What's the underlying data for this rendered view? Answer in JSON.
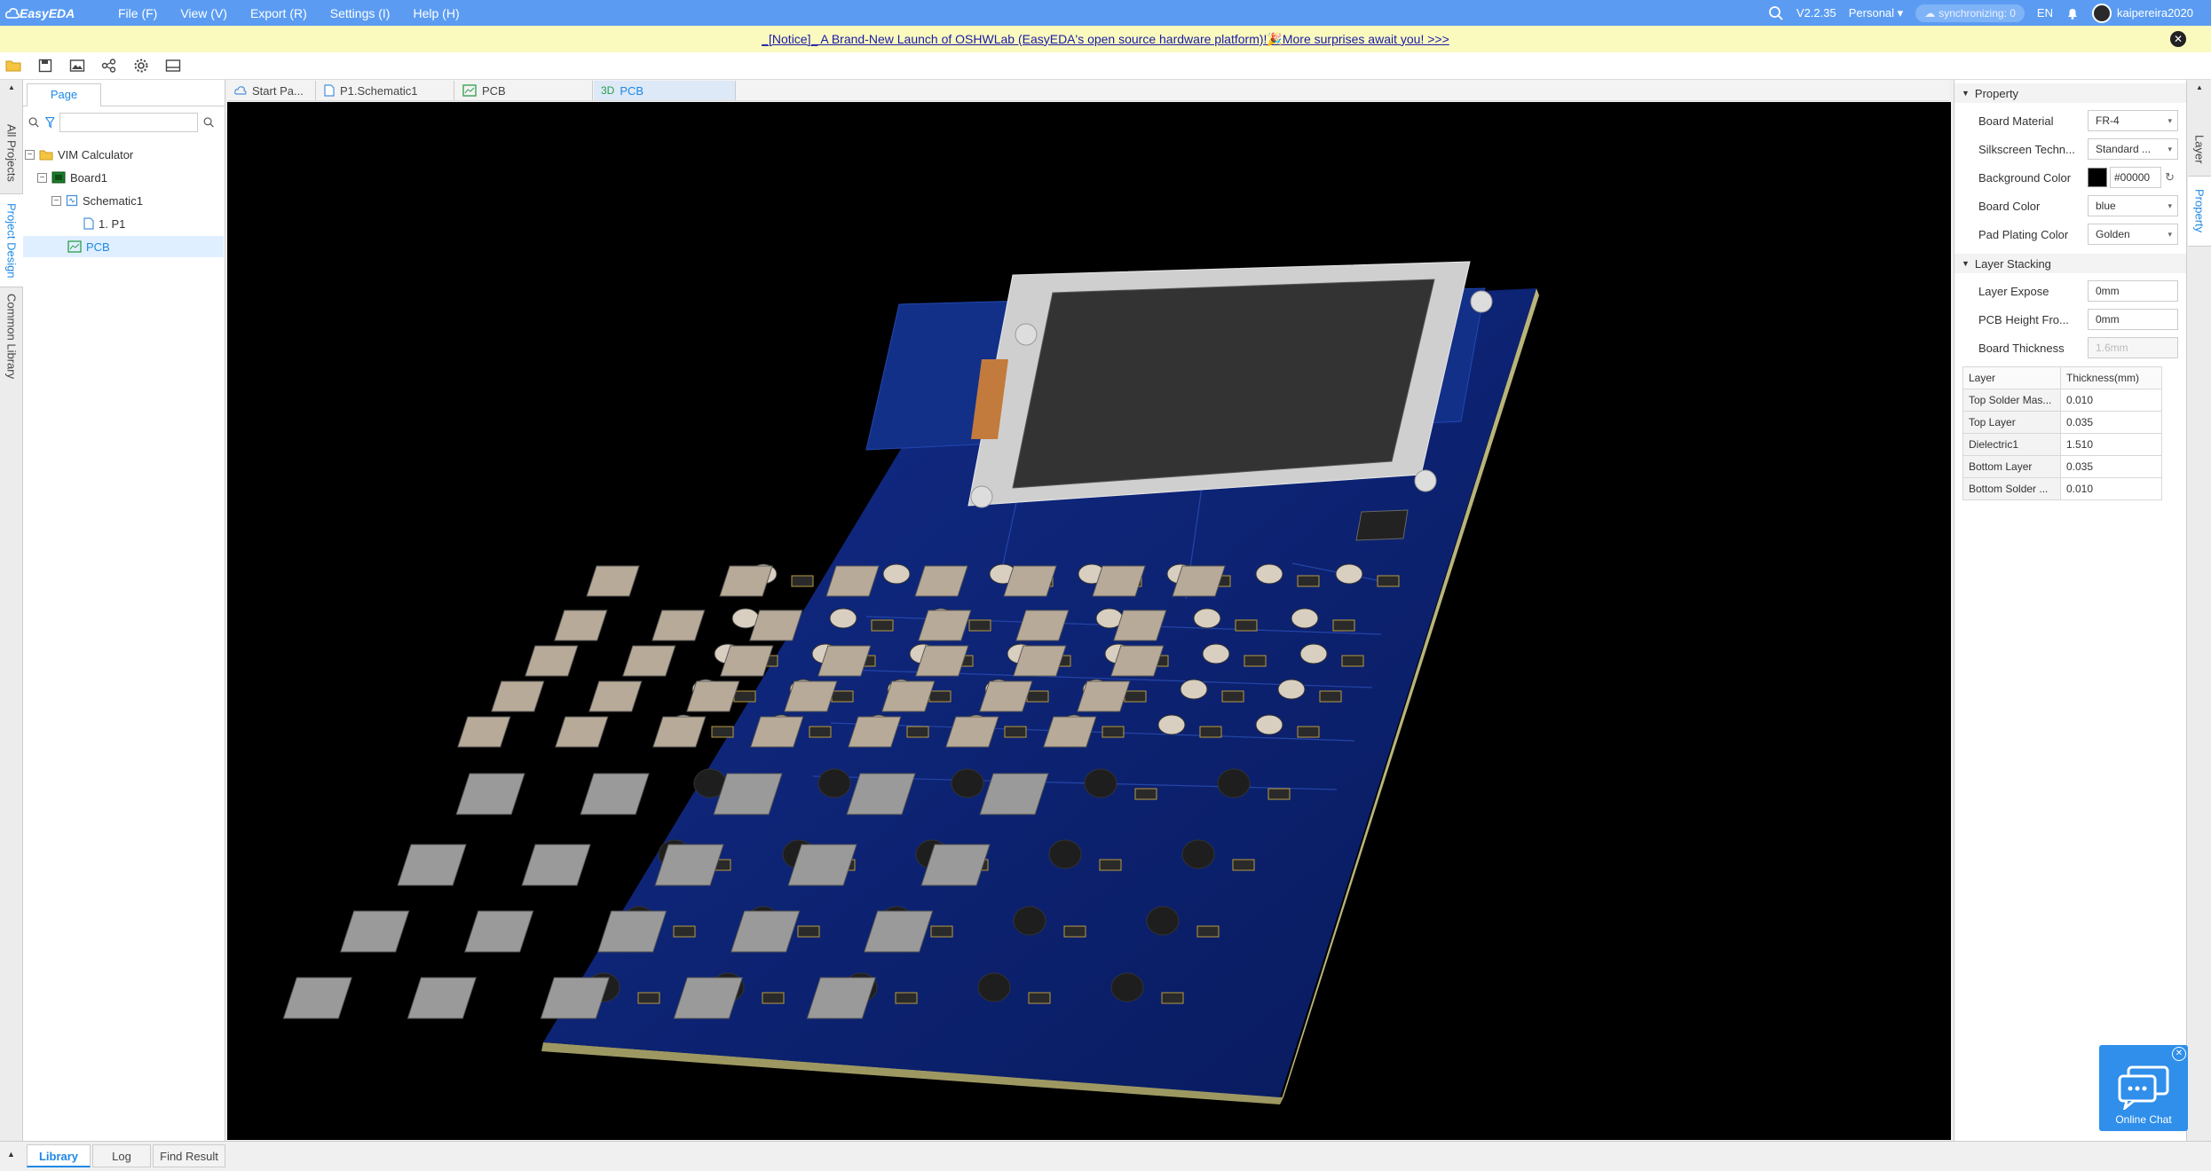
{
  "app": {
    "logo_text": "EasyEDA",
    "menu": [
      "File (F)",
      "View (V)",
      "Export (R)",
      "Settings (I)",
      "Help (H)"
    ],
    "version": "V2.2.35",
    "edition": "Personal",
    "sync_status": "synchronizing: 0",
    "language": "EN",
    "username": "kaipereira2020"
  },
  "notice": {
    "text": "_[Notice]_ A Brand-New Launch of OSHWLab (EasyEDA's open source hardware platform)!🎉More surprises await you! >>>"
  },
  "left_vtabs": [
    "All Projects",
    "Project Design",
    "Common Library"
  ],
  "left_panel": {
    "tab": "Page",
    "tree": {
      "project": "VIM Calculator",
      "board": "Board1",
      "schematic": "Schematic1",
      "sheet": "1. P1",
      "pcb": "PCB"
    }
  },
  "doc_tabs": [
    "Start Pa...",
    "P1.Schematic1",
    "PCB",
    "PCB"
  ],
  "doc_tab_3d_prefix": "3D",
  "right_vtabs": [
    "Layer",
    "Property"
  ],
  "property_panel": {
    "section_property": "Property",
    "rows": [
      {
        "label": "Board Material",
        "value": "FR-4"
      },
      {
        "label": "Silkscreen Techn...",
        "value": "Standard ..."
      },
      {
        "label": "Background Color",
        "value": "#00000"
      },
      {
        "label": "Board Color",
        "value": "blue"
      },
      {
        "label": "Pad Plating Color",
        "value": "Golden"
      }
    ],
    "section_stacking": "Layer Stacking",
    "stacking_rows": [
      {
        "label": "Layer Expose",
        "value": "0mm"
      },
      {
        "label": "PCB Height Fro...",
        "value": "0mm"
      },
      {
        "label": "Board Thickness",
        "value": "1.6mm"
      }
    ],
    "table_headers": [
      "Layer",
      "Thickness(mm)"
    ],
    "table_rows": [
      {
        "layer": "Top Solder Mas...",
        "thickness": "0.010"
      },
      {
        "layer": "Top Layer",
        "thickness": "0.035"
      },
      {
        "layer": "Dielectric1",
        "thickness": "1.510"
      },
      {
        "layer": "Bottom Layer",
        "thickness": "0.035"
      },
      {
        "layer": "Bottom Solder ...",
        "thickness": "0.010"
      }
    ]
  },
  "bottom_tabs": [
    "Library",
    "Log",
    "Find Result"
  ],
  "chat": {
    "label": "Online Chat"
  },
  "colors": {
    "accent": "#5b9cf2",
    "board": "#0a1f6b",
    "canvas": "#000000",
    "notice_bg": "#fafabe"
  }
}
